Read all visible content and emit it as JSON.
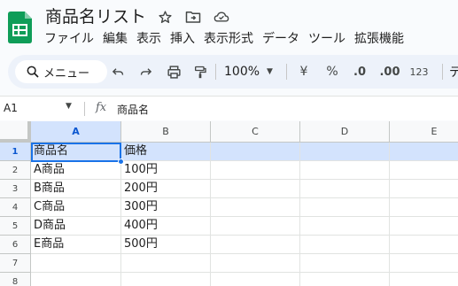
{
  "app": {
    "accent": "#1a73e8",
    "brand_green": "#0f9d58"
  },
  "title": {
    "doc_title": "商品名リスト",
    "icons": [
      "star-icon",
      "move-to-folder-icon",
      "cloud-status-icon"
    ]
  },
  "menu": [
    "ファイル",
    "編集",
    "表示",
    "挿入",
    "表示形式",
    "データ",
    "ツール",
    "拡張機能"
  ],
  "toolbar": {
    "search_label": "メニュー",
    "zoom": "100%",
    "currency": "¥",
    "percent": "%",
    "decrease_decimal": ".0",
    "increase_decimal": ".00",
    "number_format": "123",
    "font_partial": "デ"
  },
  "formula": {
    "cell_ref": "A1",
    "fx": "fx",
    "content": "商品名"
  },
  "grid": {
    "columns": [
      "A",
      "B",
      "C",
      "D",
      "E"
    ],
    "rows": [
      "1",
      "2",
      "3",
      "4",
      "5",
      "6",
      "7",
      "8"
    ],
    "data": [
      [
        "商品名",
        "価格"
      ],
      [
        "A商品",
        "100円"
      ],
      [
        "B商品",
        "200円"
      ],
      [
        "C商品",
        "300円"
      ],
      [
        "D商品",
        "400円"
      ],
      [
        "E商品",
        "500円"
      ]
    ]
  }
}
